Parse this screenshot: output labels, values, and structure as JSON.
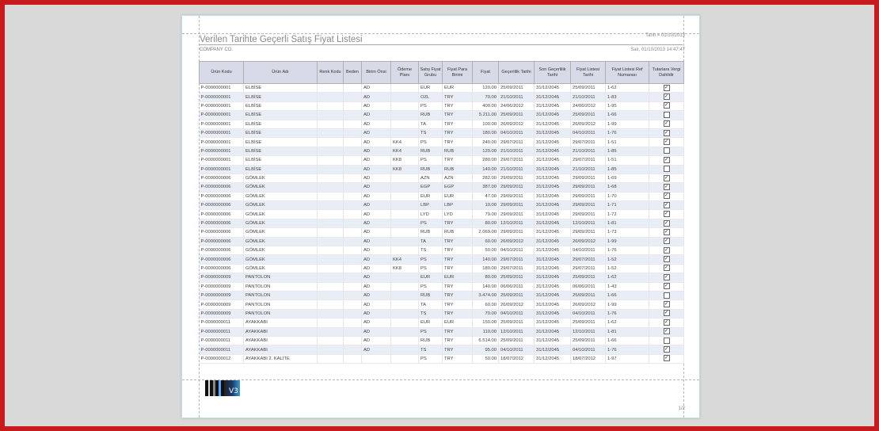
{
  "report": {
    "title": "Verilen Tarihte Geçerli Satış Fiyat Listesi",
    "company": "COMPANY CO.",
    "date_filter": "Tarih = 01/10/2013",
    "printed": "Salı, 01/10/2013 14:47:47",
    "page_number": "1/2",
    "logo_text": "V3"
  },
  "columns": [
    "Ürün Kodu",
    "Ürün Adı",
    "Renk Kodu",
    "Beden",
    "Birim Önsi",
    "Ödeme Planı",
    "Satış Fiyat Grubu",
    "Fiyat Para Birimi",
    "Fiyat",
    "Geçerlilik Tarihi",
    "Son Geçerlilik Tarihi",
    "Fiyat Listesi Tarihi",
    "Fiyat Listesi Ref Numarası",
    "Tutarlara Vergi Dahildir"
  ],
  "rows": [
    {
      "code": "P-0000000001",
      "name": "ELBİSE",
      "color": "",
      "size": "",
      "unit": "AD",
      "plan": "",
      "group": "EUR",
      "currency": "EUR",
      "price": "120.00",
      "valid": "25/09/2011",
      "valid_end": "31/12/2045",
      "list_date": "25/09/2011",
      "ref": "1-62",
      "tax": true
    },
    {
      "code": "P-0000000001",
      "name": "ELBİSE",
      "color": "",
      "size": "",
      "unit": "AD",
      "plan": "",
      "group": "OZL",
      "currency": "TRY",
      "price": "70.00",
      "valid": "21/10/2011",
      "valid_end": "31/12/2045",
      "list_date": "21/10/2011",
      "ref": "1-83",
      "tax": true
    },
    {
      "code": "P-0000000001",
      "name": "ELBİSE",
      "color": "",
      "size": "",
      "unit": "AD",
      "plan": "",
      "group": "PS",
      "currency": "TRY",
      "price": "400.00",
      "valid": "24/06/2012",
      "valid_end": "31/12/2045",
      "list_date": "24/06/2012",
      "ref": "1-95",
      "tax": true
    },
    {
      "code": "P-0000000001",
      "name": "ELBİSE",
      "color": "",
      "size": "",
      "unit": "AD",
      "plan": "",
      "group": "RUB",
      "currency": "TRY",
      "price": "5.211.00",
      "valid": "25/09/2011",
      "valid_end": "31/12/2045",
      "list_date": "25/09/2011",
      "ref": "1-66",
      "tax": false
    },
    {
      "code": "P-0000000001",
      "name": "ELBİSE",
      "color": "",
      "size": "",
      "unit": "AD",
      "plan": "",
      "group": "TA",
      "currency": "TRY",
      "price": "100.00",
      "valid": "26/09/2012",
      "valid_end": "31/12/2045",
      "list_date": "26/09/2012",
      "ref": "1-99",
      "tax": true
    },
    {
      "code": "P-0000000001",
      "name": "ELBİSE",
      "color": "",
      "size": "",
      "unit": "AD",
      "plan": "",
      "group": "TS",
      "currency": "TRY",
      "price": "180.00",
      "valid": "04/10/2011",
      "valid_end": "31/12/2045",
      "list_date": "04/10/2011",
      "ref": "1-76",
      "tax": true
    },
    {
      "code": "P-0000000001",
      "name": "ELBİSE",
      "color": "",
      "size": "",
      "unit": "AD",
      "plan": "KK4",
      "group": "PS",
      "currency": "TRY",
      "price": "240.00",
      "valid": "29/07/2011",
      "valid_end": "31/12/2045",
      "list_date": "29/07/2011",
      "ref": "1-51",
      "tax": true
    },
    {
      "code": "P-0000000001",
      "name": "ELBİSE",
      "color": "",
      "size": "",
      "unit": "AD",
      "plan": "KK4",
      "group": "RUB",
      "currency": "RUB",
      "price": "120.00",
      "valid": "21/10/2011",
      "valid_end": "31/12/2045",
      "list_date": "21/10/2011",
      "ref": "1-85",
      "tax": false
    },
    {
      "code": "P-0000000001",
      "name": "ELBİSE",
      "color": "",
      "size": "",
      "unit": "AD",
      "plan": "KK8",
      "group": "PS",
      "currency": "TRY",
      "price": "280.00",
      "valid": "29/07/2011",
      "valid_end": "31/12/2045",
      "list_date": "29/07/2011",
      "ref": "1-51",
      "tax": true
    },
    {
      "code": "P-0000000001",
      "name": "ELBİSE",
      "color": "",
      "size": "",
      "unit": "AD",
      "plan": "KK8",
      "group": "RUB",
      "currency": "RUB",
      "price": "140.00",
      "valid": "21/10/2011",
      "valid_end": "31/12/2045",
      "list_date": "21/10/2011",
      "ref": "1-85",
      "tax": false
    },
    {
      "code": "P-0000000006",
      "name": "GÖMLEK",
      "color": "",
      "size": "",
      "unit": "AD",
      "plan": "",
      "group": "AZN",
      "currency": "AZN",
      "price": "282.00",
      "valid": "29/09/2011",
      "valid_end": "31/12/2045",
      "list_date": "29/09/2011",
      "ref": "1-69",
      "tax": true
    },
    {
      "code": "P-0000000006",
      "name": "GÖMLEK",
      "color": "",
      "size": "",
      "unit": "AD",
      "plan": "",
      "group": "EGP",
      "currency": "EGP",
      "price": "387.00",
      "valid": "29/09/2011",
      "valid_end": "31/12/2045",
      "list_date": "29/09/2011",
      "ref": "1-68",
      "tax": true
    },
    {
      "code": "P-0000000006",
      "name": "GÖMLEK",
      "color": "",
      "size": "",
      "unit": "AD",
      "plan": "",
      "group": "EUR",
      "currency": "EUR",
      "price": "47.00",
      "valid": "29/09/2011",
      "valid_end": "31/12/2045",
      "list_date": "29/09/2011",
      "ref": "1-70",
      "tax": true
    },
    {
      "code": "P-0000000006",
      "name": "GÖMLEK",
      "color": "",
      "size": "",
      "unit": "AD",
      "plan": "",
      "group": "LBP",
      "currency": "LBP",
      "price": "10.00",
      "valid": "29/09/2011",
      "valid_end": "31/12/2045",
      "list_date": "29/09/2011",
      "ref": "1-71",
      "tax": true
    },
    {
      "code": "P-0000000006",
      "name": "GÖMLEK",
      "color": "",
      "size": "",
      "unit": "AD",
      "plan": "",
      "group": "LYD",
      "currency": "LYD",
      "price": "79.00",
      "valid": "29/09/2011",
      "valid_end": "31/12/2045",
      "list_date": "29/09/2011",
      "ref": "1-72",
      "tax": true
    },
    {
      "code": "P-0000000006",
      "name": "GÖMLEK",
      "color": "",
      "size": "",
      "unit": "AD",
      "plan": "",
      "group": "PS",
      "currency": "TRY",
      "price": "80.00",
      "valid": "12/10/2011",
      "valid_end": "31/12/2045",
      "list_date": "12/10/2011",
      "ref": "1-81",
      "tax": true
    },
    {
      "code": "P-0000000006",
      "name": "GÖMLEK",
      "color": "",
      "size": "",
      "unit": "AD",
      "plan": "",
      "group": "RUB",
      "currency": "RUB",
      "price": "2.069.00",
      "valid": "29/09/2011",
      "valid_end": "31/12/2045",
      "list_date": "29/09/2011",
      "ref": "1-73",
      "tax": true
    },
    {
      "code": "P-0000000006",
      "name": "GÖMLEK",
      "color": "",
      "size": "",
      "unit": "AD",
      "plan": "",
      "group": "TA",
      "currency": "TRY",
      "price": "60.00",
      "valid": "26/09/2012",
      "valid_end": "31/12/2045",
      "list_date": "26/09/2012",
      "ref": "1-99",
      "tax": true
    },
    {
      "code": "P-0000000006",
      "name": "GÖMLEK",
      "color": "",
      "size": "",
      "unit": "AD",
      "plan": "",
      "group": "TS",
      "currency": "TRY",
      "price": "50.00",
      "valid": "04/10/2011",
      "valid_end": "31/12/2045",
      "list_date": "04/10/2011",
      "ref": "1-76",
      "tax": true
    },
    {
      "code": "P-0000000006",
      "name": "GÖMLEK",
      "color": "",
      "size": "",
      "unit": "AD",
      "plan": "KK4",
      "group": "PS",
      "currency": "TRY",
      "price": "140.00",
      "valid": "29/07/2011",
      "valid_end": "31/12/2045",
      "list_date": "29/07/2011",
      "ref": "1-52",
      "tax": true
    },
    {
      "code": "P-0000000006",
      "name": "GÖMLEK",
      "color": "",
      "size": "",
      "unit": "AD",
      "plan": "KK8",
      "group": "PS",
      "currency": "TRY",
      "price": "180.00",
      "valid": "29/07/2011",
      "valid_end": "31/12/2045",
      "list_date": "29/07/2011",
      "ref": "1-52",
      "tax": true
    },
    {
      "code": "P-0000000009",
      "name": "PANTOLON",
      "color": "",
      "size": "",
      "unit": "AD",
      "plan": "",
      "group": "EUR",
      "currency": "EUR",
      "price": "80.00",
      "valid": "25/09/2011",
      "valid_end": "31/12/2045",
      "list_date": "25/09/2011",
      "ref": "1-62",
      "tax": true
    },
    {
      "code": "P-0000000009",
      "name": "PANTOLON",
      "color": "",
      "size": "",
      "unit": "AD",
      "plan": "",
      "group": "PS",
      "currency": "TRY",
      "price": "140.00",
      "valid": "06/06/2011",
      "valid_end": "31/12/2045",
      "list_date": "06/06/2011",
      "ref": "1-43",
      "tax": true
    },
    {
      "code": "P-0000000009",
      "name": "PANTOLON",
      "color": "",
      "size": "",
      "unit": "AD",
      "plan": "",
      "group": "RUB",
      "currency": "TRY",
      "price": "3.474.00",
      "valid": "25/09/2011",
      "valid_end": "31/12/2045",
      "list_date": "25/09/2011",
      "ref": "1-66",
      "tax": false
    },
    {
      "code": "P-0000000009",
      "name": "PANTOLON",
      "color": "",
      "size": "",
      "unit": "AD",
      "plan": "",
      "group": "TA",
      "currency": "TRY",
      "price": "60.00",
      "valid": "26/09/2012",
      "valid_end": "31/12/2045",
      "list_date": "26/09/2012",
      "ref": "1-99",
      "tax": true
    },
    {
      "code": "P-0000000009",
      "name": "PANTOLON",
      "color": "",
      "size": "",
      "unit": "AD",
      "plan": "",
      "group": "TS",
      "currency": "TRY",
      "price": "70.00",
      "valid": "04/10/2011",
      "valid_end": "31/12/2045",
      "list_date": "04/10/2011",
      "ref": "1-76",
      "tax": true
    },
    {
      "code": "P-0000000011",
      "name": "AYAKKABI",
      "color": "",
      "size": "",
      "unit": "AD",
      "plan": "",
      "group": "EUR",
      "currency": "EUR",
      "price": "150.00",
      "valid": "25/09/2011",
      "valid_end": "31/12/2045",
      "list_date": "25/09/2011",
      "ref": "1-62",
      "tax": true
    },
    {
      "code": "P-0000000011",
      "name": "AYAKKABI",
      "color": "",
      "size": "",
      "unit": "AD",
      "plan": "",
      "group": "PS",
      "currency": "TRY",
      "price": "110.00",
      "valid": "12/10/2011",
      "valid_end": "31/12/2045",
      "list_date": "12/10/2011",
      "ref": "1-81",
      "tax": true
    },
    {
      "code": "P-0000000011",
      "name": "AYAKKABI",
      "color": "",
      "size": "",
      "unit": "AD",
      "plan": "",
      "group": "RUB",
      "currency": "TRY",
      "price": "6.514.00",
      "valid": "25/09/2011",
      "valid_end": "31/12/2045",
      "list_date": "25/09/2011",
      "ref": "1-66",
      "tax": false
    },
    {
      "code": "P-0000000011",
      "name": "AYAKKABI",
      "color": "",
      "size": "",
      "unit": "AD",
      "plan": "",
      "group": "TS",
      "currency": "TRY",
      "price": "95.00",
      "valid": "04/10/2011",
      "valid_end": "31/12/2045",
      "list_date": "04/10/2011",
      "ref": "1-76",
      "tax": true
    },
    {
      "code": "P-0000000012",
      "name": "AYAKKABI 2. KALİTE",
      "color": "",
      "size": "",
      "unit": "",
      "plan": "",
      "group": "PS",
      "currency": "TRY",
      "price": "50.00",
      "valid": "18/07/2012",
      "valid_end": "31/12/2045",
      "list_date": "18/07/2012",
      "ref": "1-97",
      "tax": true
    }
  ],
  "colors": {
    "frame": "#c8191c",
    "header_bg": "#d8dbe7",
    "alt_row": "#e9edf5"
  }
}
